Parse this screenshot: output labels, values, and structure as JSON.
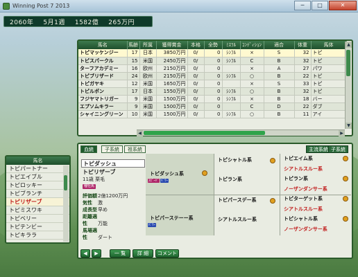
{
  "window": {
    "title": "Winning Post 7 2013",
    "minimize": "─",
    "maximize": "□",
    "close": "✕"
  },
  "status": {
    "year": "2060年",
    "date": "5月1週",
    "money": "1582億",
    "amount": "265万円"
  },
  "table": {
    "headers": [
      "馬名",
      "馬齢",
      "所属",
      "獲得賞金",
      "本格",
      "全勢",
      "ﾐｽﾗﾙ",
      "ｺﾝﾃﾞｨｼｮﾝ",
      "適合",
      "体重",
      "馬体"
    ],
    "rows": [
      [
        "トピマッケンジー",
        "17",
        "日本",
        "3850万円",
        "0/",
        "0",
        "ｼﾝﾌﾙ",
        "×",
        "S",
        "32",
        "トピ"
      ],
      [
        "トピスパークル",
        "15",
        "米国",
        "2450万円",
        "0/",
        "0",
        "ｼﾝﾌﾙ",
        "C",
        "B",
        "32",
        "トピ"
      ],
      [
        "ターフアカデミー",
        "16",
        "欧州",
        "2150万円",
        "0/",
        "0",
        "",
        "×",
        "A",
        "27",
        "パワ"
      ],
      [
        "トピブリザード",
        "24",
        "欧州",
        "2150万円",
        "0/",
        "0",
        "ｼﾝﾌﾙ",
        "○",
        "B",
        "22",
        "トピ"
      ],
      [
        "トピガヤキ",
        "12",
        "米国",
        "1650万円",
        "0/",
        "0",
        "",
        "×",
        "S",
        "33",
        "トピ"
      ],
      [
        "トピルポン",
        "17",
        "日本",
        "1550万円",
        "0/",
        "0",
        "ｼﾝﾌﾙ",
        "○",
        "B",
        "32",
        "トピ"
      ],
      [
        "フジヤマトリガー",
        "9",
        "米国",
        "1500万円",
        "0/",
        "0",
        "ｼﾝﾌﾙ",
        "×",
        "B",
        "18",
        "バー"
      ],
      [
        "エプソムキラー",
        "9",
        "米国",
        "1500万円",
        "0/",
        "0",
        "",
        "C",
        "D",
        "22",
        "ダブ"
      ],
      [
        "シャイニングリーン",
        "10",
        "米国",
        "1500万円",
        "0/",
        "0",
        "ｼﾝﾌﾙ",
        "○",
        "B",
        "11",
        "アイ"
      ]
    ]
  },
  "list": {
    "header": "馬名",
    "items": [
      "トピパートナー",
      "トピエイブル",
      "トピロッキー",
      "トピブランチ",
      "トピリザーブ",
      "トピミスワキ",
      "トピベリー",
      "トピテンビー",
      "トピキララ"
    ],
    "active_index": 4
  },
  "pedigree": {
    "tabs": [
      "血統",
      "子系統",
      "祖系統"
    ],
    "right_tabs": [
      "主流系統",
      "子系統"
    ],
    "sire_line": "トピダッシュ",
    "horse": "トピリザーブ",
    "age_sex": "11歳 栗毛",
    "badge": "種牡馬",
    "stats": [
      {
        "label": "評価額",
        "value": "2億1200万円"
      },
      {
        "label": "気性",
        "value": "激"
      },
      {
        "label": "成長型",
        "value": "早め"
      },
      {
        "label": "距離適性",
        "value": "万能"
      },
      {
        "label": "馬場適性",
        "value": "ダート"
      }
    ],
    "sire": "トピダッシュ系",
    "dam": "トピパーステーー系",
    "gen2": [
      "トピシャトル系",
      "トピラン系",
      "トピパースデー系",
      "シアトルスルー系"
    ],
    "gen3": [
      "トピエイム系",
      "シアトルスルー系",
      "トピラン系",
      "ノーザンダンサー系",
      "トピターゲット系",
      "シアトルスルー系",
      "トピシャトル系",
      "ノーザンダンサー系"
    ],
    "badges": {
      "a": "ｽﾋﾟｰﾄﾞ",
      "b": "ﾊﾟﾜｰ",
      "c": "ﾀﾌ"
    }
  },
  "buttons": {
    "prev": "◀",
    "next": "▶",
    "list": "一 覧",
    "detail": "詳 細",
    "comment": "コメント"
  }
}
